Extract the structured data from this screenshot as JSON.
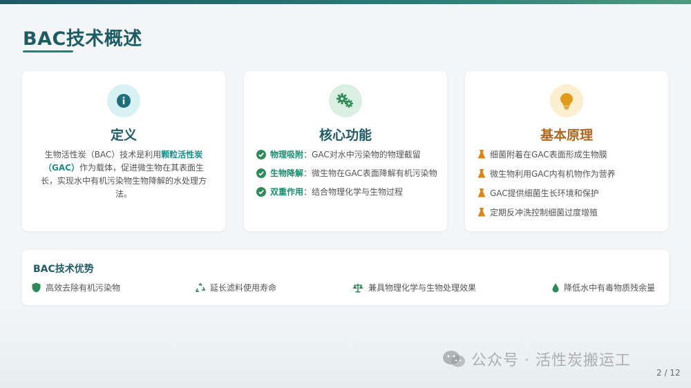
{
  "header": {
    "title": "BAC技术概述"
  },
  "cards": {
    "definition": {
      "icon": "info-icon",
      "title": "定义",
      "text_before": "生物活性炭（BAC）技术是利用",
      "highlight": "颗粒活性炭（GAC）",
      "text_after": "作为载体，促进微生物在其表面生长，实现水中有机污染物生物降解的水处理方法。"
    },
    "core_functions": {
      "icon": "gears-icon",
      "title": "核心功能",
      "items": [
        {
          "name": "物理吸附",
          "desc": "：GAC对水中污染物的物理截留"
        },
        {
          "name": "生物降解",
          "desc": "：微生物在GAC表面降解有机污染物"
        },
        {
          "name": "双重作用",
          "desc": "：结合物理化学与生物过程"
        }
      ]
    },
    "principles": {
      "icon": "lightbulb-icon",
      "title": "基本原理",
      "items": [
        "细菌附着在GAC表面形成生物膜",
        "微生物利用GAC内有机物作为营养",
        "GAC提供细菌生长环境和保护",
        "定期反冲洗控制细菌过度增殖"
      ]
    }
  },
  "advantages": {
    "title": "BAC技术优势",
    "items": [
      {
        "icon": "shield-icon",
        "label": "高效去除有机污染物"
      },
      {
        "icon": "recycle-icon",
        "label": "延长滤料使用寿命"
      },
      {
        "icon": "balance-scale-icon",
        "label": "兼具物理化学与生物处理效果"
      },
      {
        "icon": "water-drop-icon",
        "label": "降低水中有毒物质残余量"
      }
    ]
  },
  "watermark": "公众号 · 活性炭搬运工",
  "page": "2 / 12",
  "colors": {
    "primary": "#1f5a66",
    "accent_green": "#2e8b57",
    "accent_orange": "#b0651a"
  }
}
